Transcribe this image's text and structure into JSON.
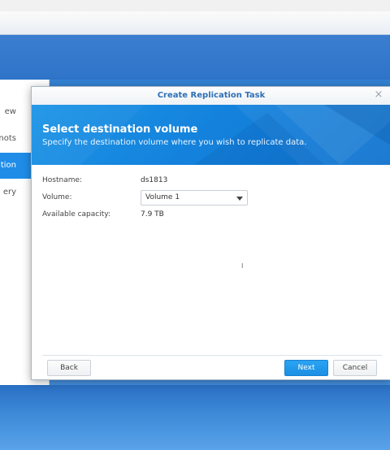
{
  "background_window": {
    "items": [
      {
        "label": "ew"
      },
      {
        "label": "nots"
      },
      {
        "label": "ation",
        "active": true
      },
      {
        "label": "ery"
      }
    ]
  },
  "dialog": {
    "title": "Create Replication Task",
    "close_icon": "×",
    "banner": {
      "heading": "Select destination volume",
      "subtitle": "Specify the destination volume where you wish to replicate data."
    },
    "form": {
      "hostname_label": "Hostname:",
      "hostname_value": "ds1813",
      "volume_label": "Volume:",
      "volume_value": "Volume 1",
      "capacity_label": "Available capacity:",
      "capacity_value": "7.9 TB"
    },
    "buttons": {
      "back": "Back",
      "next": "Next",
      "cancel": "Cancel"
    }
  },
  "colors": {
    "accent": "#1f8de8",
    "title_blue": "#2d6fb6"
  }
}
